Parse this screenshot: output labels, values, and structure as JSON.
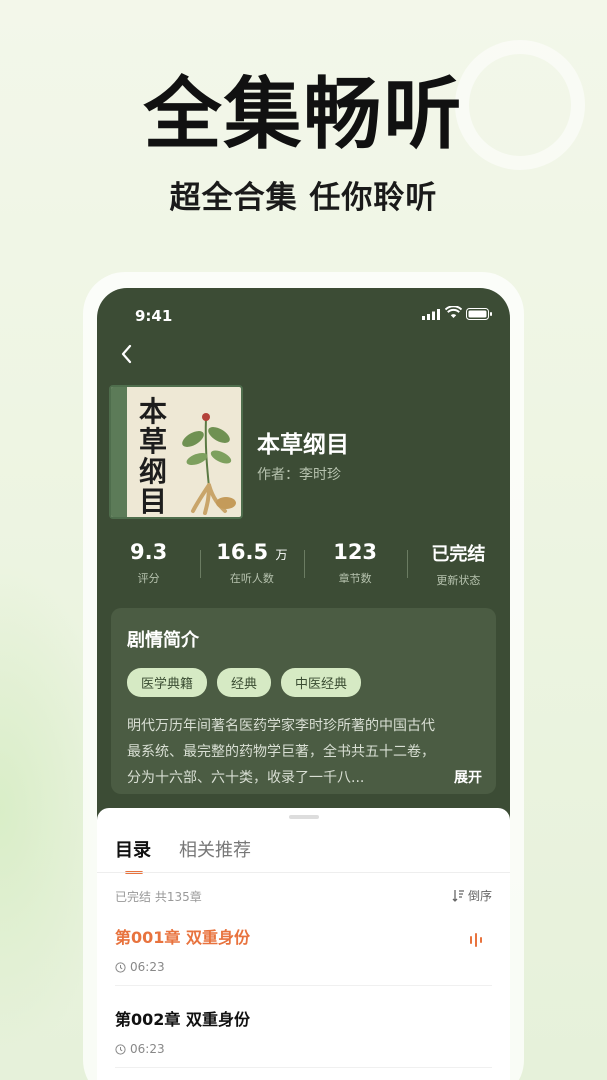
{
  "hero": {
    "title": "全集畅听",
    "subtitle": "超全合集 任你聆听"
  },
  "status_bar": {
    "time": "9:41"
  },
  "book": {
    "cover_title": "本草纲目",
    "title": "本草纲目",
    "author": "作者：李时珍"
  },
  "stats": [
    {
      "value": "9.3",
      "unit": "",
      "label": "评分"
    },
    {
      "value": "16.5",
      "unit": "万",
      "label": "在听人数"
    },
    {
      "value": "123",
      "unit": "",
      "label": "章节数"
    },
    {
      "value": "已完结",
      "unit": "",
      "label": "更新状态"
    }
  ],
  "intro": {
    "heading": "剧情简介",
    "tags": [
      "医学典籍",
      "经典",
      "中医经典"
    ],
    "text": "明代万历年间著名医药学家李时珍所著的中国古代最系统、最完整的药物学巨著，全书共五十二卷，分为十六部、六十类，收录了一千八...",
    "expand": "展开"
  },
  "sheet": {
    "tabs": [
      "目录",
      "相关推荐"
    ],
    "meta": "已完结 共135章",
    "sort_label": "倒序",
    "chapters": [
      {
        "title": "第001章 双重身份",
        "duration": "06:23",
        "playing": true
      },
      {
        "title": "第002章 双重身份",
        "duration": "06:23",
        "playing": false
      }
    ]
  },
  "colors": {
    "accent": "#e8733e",
    "panel": "#3c4c35",
    "tag_bg": "#d6eac4"
  }
}
